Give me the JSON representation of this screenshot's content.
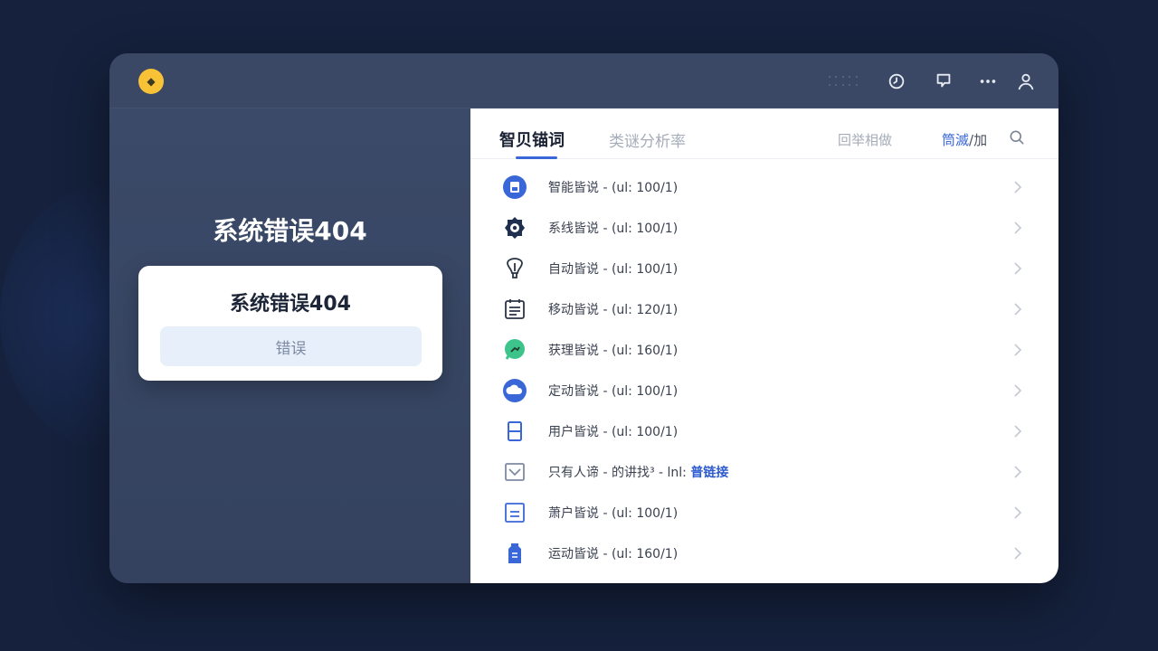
{
  "topbar": {
    "logo_glyph": "◆",
    "icons": [
      "history-icon",
      "chat-icon",
      "more-icon",
      "user-icon"
    ]
  },
  "left": {
    "title": "系统错误404",
    "card_title": "系统错误404",
    "card_button": "错误"
  },
  "right": {
    "tabs": [
      {
        "label": "智贝锚词",
        "active": true
      },
      {
        "label": "类谜分析率",
        "active": false
      }
    ],
    "secondary_tab": "回举相做",
    "filter_label": "筒滅",
    "filter_suffix": "/加"
  },
  "list": [
    {
      "text": "智能皆说 - (ul: 100/1)",
      "icon": "save-icon",
      "color": "#3a67d8"
    },
    {
      "text": "系线皆说 - (ul: 100/1)",
      "icon": "camera-icon",
      "color": "#1f2f4f"
    },
    {
      "text": "自动皆说 - (ul: 100/1)",
      "icon": "bulb-icon",
      "color": "#2b3445"
    },
    {
      "text": "移动皆说 - (ul: 120/1)",
      "icon": "calendar-icon",
      "color": "#2b3445"
    },
    {
      "text": "获理皆说 - (ul: 160/1)",
      "icon": "chat-bubble-icon",
      "color": "#3cc48a"
    },
    {
      "text": "定动皆说 - (ul: 100/1)",
      "icon": "cloud-icon",
      "color": "#3a67d8"
    },
    {
      "text": "用户皆说 - (ul: 100/1)",
      "icon": "panel-icon",
      "color": "#3a67d8"
    },
    {
      "text": "只有人谛 - 的讲找³ - lnl:",
      "link": "普链接",
      "icon": "mail-icon",
      "color": "#7f8aa0"
    },
    {
      "text": "萧户皆说 - (ul: 100/1)",
      "icon": "document-icon",
      "color": "#3a67d8"
    },
    {
      "text": "运动皆说 - (ul: 160/1)",
      "icon": "tag-icon",
      "color": "#3a67d8"
    }
  ]
}
